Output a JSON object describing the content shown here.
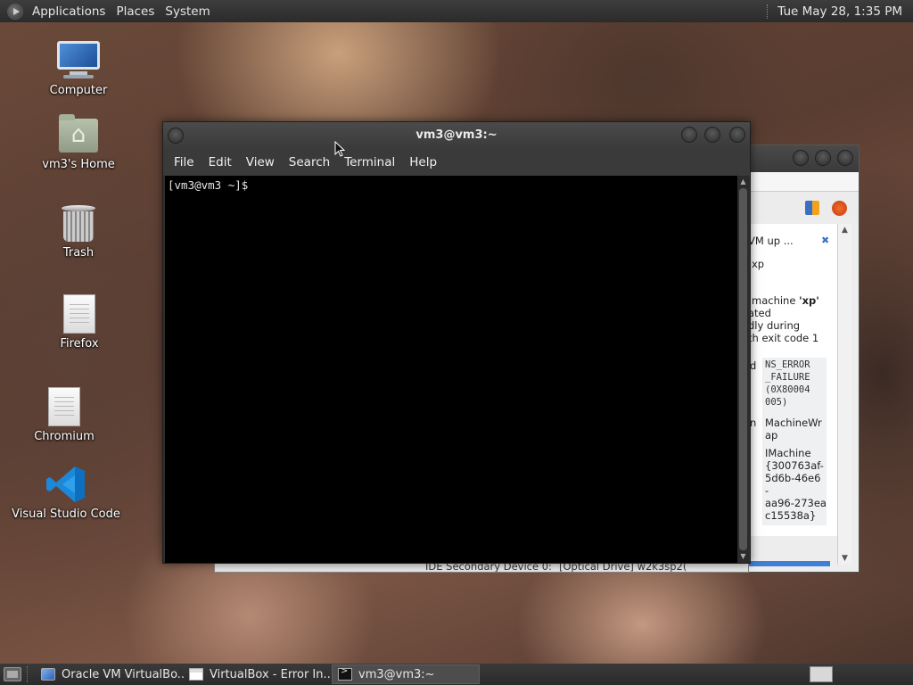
{
  "top_panel": {
    "menus": [
      "Applications",
      "Places",
      "System"
    ],
    "clock": "Tue May 28,  1:35 PM"
  },
  "desktop_icons": [
    {
      "label": "Computer",
      "icon": "computer-icon"
    },
    {
      "label": "vm3's Home",
      "icon": "home-folder-icon"
    },
    {
      "label": "Trash",
      "icon": "trash-icon"
    },
    {
      "label": "Firefox",
      "icon": "document-icon"
    },
    {
      "label": "Chromium",
      "icon": "document-icon"
    },
    {
      "label": "Visual Studio Code",
      "icon": "vscode-icon"
    }
  ],
  "terminal": {
    "title": "vm3@vm3:~",
    "menu": [
      "File",
      "Edit",
      "View",
      "Search",
      "Terminal",
      "Help"
    ],
    "prompt": "[vm3@vm3 ~]$"
  },
  "vbox_error": {
    "lines": [
      "VM up ...",
      "xp",
      "machine 'xp'",
      "ated",
      "dly during",
      "th exit code 1"
    ],
    "details_left": [
      "d",
      "n"
    ],
    "details": [
      "NS_ERROR",
      "_FAILURE",
      "(0X80004",
      "005)",
      "MachineWr",
      "ap",
      "IMachine",
      "{300763af-",
      "5d6b-46e6",
      "-",
      "aa96-273ea",
      "c15538a}"
    ]
  },
  "behind_window": {
    "label": "IDE Secondary Device 0:",
    "value": "[Optical Drive] w2k3sp2("
  },
  "taskbar": {
    "tasks": [
      {
        "label": "Oracle VM VirtualBo...",
        "icon": "virtualbox-icon",
        "active": false
      },
      {
        "label": "VirtualBox - Error In...",
        "icon": "window-icon",
        "active": false
      },
      {
        "label": "vm3@vm3:~",
        "icon": "terminal-icon",
        "active": true
      }
    ]
  },
  "colors": {
    "panel": "#2f2f2f",
    "terminal_bg": "#000000",
    "accent_blue": "#3d73c9"
  }
}
